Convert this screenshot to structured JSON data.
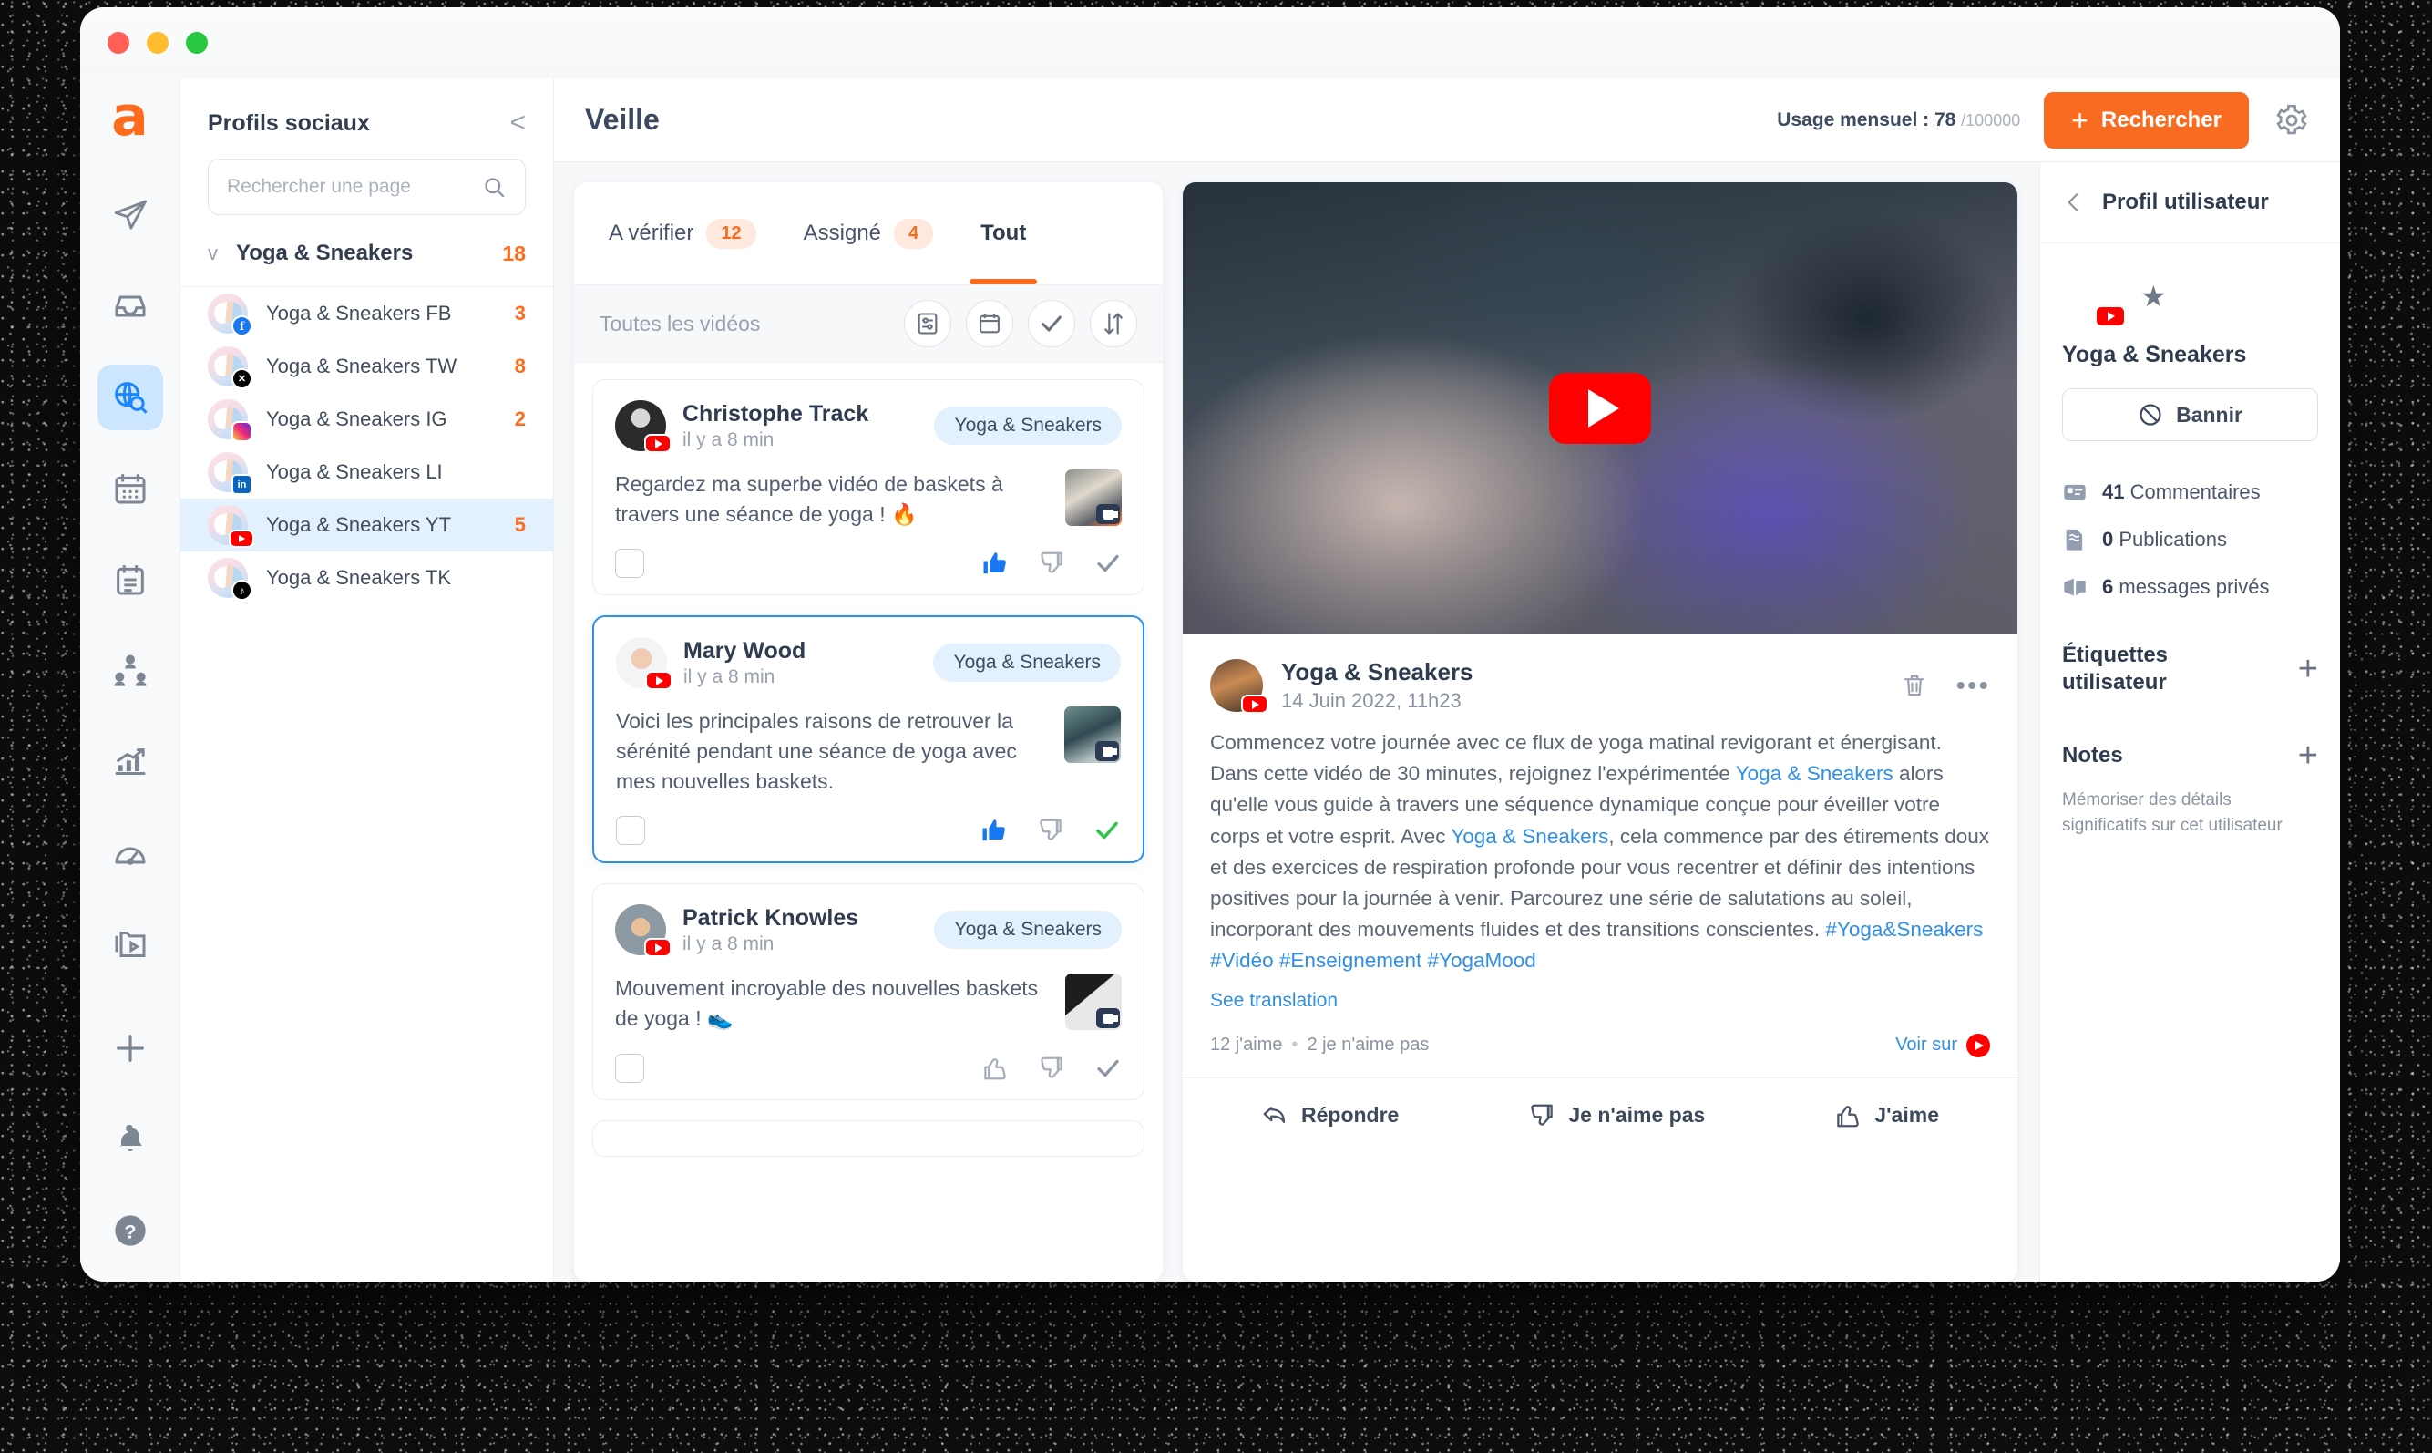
{
  "window": {
    "traffic_lights": [
      "close",
      "minimize",
      "maximize"
    ]
  },
  "rail": {
    "logo": "a",
    "items": [
      {
        "name": "publish-icon",
        "label": "Publier"
      },
      {
        "name": "inbox-icon",
        "label": "Boîte de réception"
      },
      {
        "name": "listening-globe-icon",
        "label": "Veille",
        "active": true
      },
      {
        "name": "calendar-icon",
        "label": "Calendrier"
      },
      {
        "name": "notes-icon",
        "label": "Notes"
      },
      {
        "name": "community-icon",
        "label": "Communauté"
      },
      {
        "name": "analytics-icon",
        "label": "Analytique"
      },
      {
        "name": "gauge-icon",
        "label": "Performance"
      },
      {
        "name": "media-library-icon",
        "label": "Médiathèque"
      },
      {
        "name": "add-icon",
        "label": "Ajouter"
      },
      {
        "name": "bell-icon",
        "label": "Notifications"
      },
      {
        "name": "help-icon",
        "label": "Aide"
      }
    ]
  },
  "profiles_panel": {
    "title": "Profils sociaux",
    "collapse_label": "<",
    "search_placeholder": "Rechercher une page",
    "search_value": "",
    "group": {
      "name": "Yoga & Sneakers",
      "count": "18",
      "caret": "v"
    },
    "items": [
      {
        "label": "Yoga & Sneakers FB",
        "network": "fb",
        "badge_glyph": "f",
        "count": "3",
        "selected": false
      },
      {
        "label": "Yoga & Sneakers TW",
        "network": "tw",
        "badge_glyph": "✕",
        "count": "8",
        "selected": false
      },
      {
        "label": "Yoga & Sneakers IG",
        "network": "ig",
        "badge_glyph": "◎",
        "count": "2",
        "selected": false
      },
      {
        "label": "Yoga & Sneakers LI",
        "network": "li",
        "badge_glyph": "in",
        "count": "",
        "selected": false
      },
      {
        "label": "Yoga & Sneakers YT",
        "network": "yt",
        "badge_glyph": "",
        "count": "5",
        "selected": true
      },
      {
        "label": "Yoga & Sneakers TK",
        "network": "tk",
        "badge_glyph": "♪",
        "count": "",
        "selected": false
      }
    ]
  },
  "header": {
    "page_title": "Veille",
    "usage_label": "Usage mensuel : 78",
    "usage_limit": "/100000",
    "search_button": "Rechercher",
    "search_button_plus": "+",
    "settings_icon": "gear-icon"
  },
  "list": {
    "tabs": [
      {
        "label": "A vérifier",
        "badge": "12",
        "active": false
      },
      {
        "label": "Assigné",
        "badge": "4",
        "active": false
      },
      {
        "label": "Tout",
        "badge": "",
        "active": true
      }
    ],
    "filter_label": "Toutes les vidéos",
    "filter_buttons": [
      "sliders-icon",
      "calendar-icon",
      "check-icon",
      "sort-icon"
    ],
    "comments": [
      {
        "author": "Christophe Track",
        "time": "il y a 8 min",
        "tag": "Yoga & Sneakers",
        "text": "Regardez ma superbe vidéo de baskets à travers une séance de yoga ! 🔥",
        "thumb": "t1",
        "avatar": "p1",
        "selected": false,
        "like_state": "liked",
        "dislike_state": "off",
        "check_state": "off"
      },
      {
        "author": "Mary Wood",
        "time": "il y a 8 min",
        "tag": "Yoga & Sneakers",
        "text": "Voici les principales raisons de retrouver la sérénité pendant une séance de yoga avec mes nouvelles baskets.",
        "thumb": "t2",
        "avatar": "p2",
        "selected": true,
        "like_state": "liked",
        "dislike_state": "off",
        "check_state": "done"
      },
      {
        "author": "Patrick Knowles",
        "time": "il y a 8 min",
        "tag": "Yoga & Sneakers",
        "text": "Mouvement incroyable des nouvelles baskets de yoga ! 👟",
        "thumb": "t3",
        "avatar": "p3",
        "selected": false,
        "like_state": "off",
        "dislike_state": "off",
        "check_state": "off"
      }
    ]
  },
  "post": {
    "play_icon": "youtube-play-icon",
    "author": "Yoga & Sneakers",
    "date": "14 Juin 2022, 11h23",
    "delete_icon": "trash-icon",
    "more_icon": "more-icon",
    "body_1": "Commencez votre journée avec ce flux de yoga matinal revigorant et énergisant. Dans cette vidéo de 30 minutes, rejoignez l'expérimentée ",
    "mention_1": "Yoga & Sneakers",
    "body_2": " alors qu'elle vous guide à travers une séquence dynamique conçue pour éveiller votre corps et votre esprit. Avec ",
    "mention_2": "Yoga & Sneakers",
    "body_3": ", cela commence par des étirements doux et des exercices de respiration profonde pour vous recentrer et définir des intentions positives pour la journée à venir. Parcourez une série de salutations au soleil, incorporant des mouvements fluides et des transitions conscientes. ",
    "hashtags": "#Yoga&Sneakers #Vidéo #Enseignement #YogaMood",
    "see_translation": "See translation",
    "likes": "12 j'aime",
    "dislikes": "2 je n'aime pas",
    "view_on": "Voir sur",
    "actions": [
      {
        "label": "Répondre",
        "icon": "reply-icon"
      },
      {
        "label": "Je n'aime pas",
        "icon": "thumbs-down-icon"
      },
      {
        "label": "J'aime",
        "icon": "thumbs-up-icon"
      }
    ]
  },
  "right_panel": {
    "back_icon": "chevron-left-icon",
    "title": "Profil utilisateur",
    "user_name": "Yoga & Sneakers",
    "star_icon": "star-icon",
    "ban_button": "Bannir",
    "stats": [
      {
        "value": "41",
        "label": "Commentaires",
        "icon": "comment-icon"
      },
      {
        "value": "0",
        "label": "Publications",
        "icon": "document-icon"
      },
      {
        "value": "6",
        "label": "messages privés",
        "icon": "message-icon"
      }
    ],
    "tags_section": {
      "title": "Étiquettes utilisateur",
      "add": "+"
    },
    "notes_section": {
      "title": "Notes",
      "add": "+",
      "hint": "Mémoriser des détails significatifs sur cet utilisateur"
    }
  }
}
